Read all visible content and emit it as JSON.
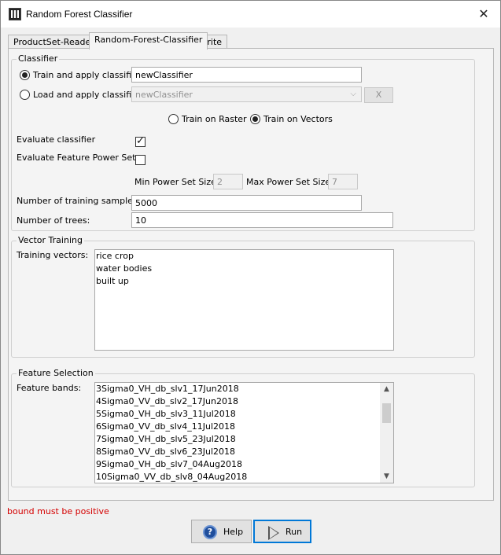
{
  "window": {
    "title": "Random Forest Classifier",
    "close_glyph": "✕",
    "app_icon": "raster-grid-icon"
  },
  "tabs": [
    {
      "label": "ProductSet-Reader",
      "active": false
    },
    {
      "label": "Random-Forest-Classifier",
      "active": true
    },
    {
      "label": "Write",
      "active": false
    }
  ],
  "classifier": {
    "legend": "Classifier",
    "train_apply_label": "Train and apply classifier",
    "train_apply_selected": true,
    "train_apply_name": "newClassifier",
    "load_apply_label": "Load and apply classifier",
    "load_apply_selected": false,
    "load_apply_name": "newClassifier",
    "delete_button_label": "X",
    "train_on_raster_label": "Train on Raster",
    "train_on_vectors_label": "Train on Vectors",
    "train_mode_selected": "vectors",
    "evaluate_classifier_label": "Evaluate classifier",
    "evaluate_classifier_checked": true,
    "evaluate_feature_power_set_label": "Evaluate Feature Power Set",
    "evaluate_feature_power_set_checked": false,
    "min_power_set_label": "Min Power Set Size:",
    "min_power_set_value": "2",
    "max_power_set_label": "Max Power Set Size:",
    "max_power_set_value": "7",
    "num_training_samples_label": "Number of training samples",
    "num_training_samples_value": "5000",
    "num_trees_label": "Number of trees:",
    "num_trees_value": "10"
  },
  "vector_training": {
    "legend": "Vector Training",
    "training_vectors_label": "Training vectors:",
    "items": [
      "rice crop",
      "water bodies",
      "built up"
    ]
  },
  "feature_selection": {
    "legend": "Feature Selection",
    "feature_bands_label": "Feature bands:",
    "items": [
      "3Sigma0_VH_db_slv1_17Jun2018",
      "4Sigma0_VV_db_slv2_17Jun2018",
      "5Sigma0_VH_db_slv3_11Jul2018",
      "6Sigma0_VV_db_slv4_11Jul2018",
      "7Sigma0_VH_db_slv5_23Jul2018",
      "8Sigma0_VV_db_slv6_23Jul2018",
      "9Sigma0_VH_db_slv7_04Aug2018",
      "10Sigma0_VV_db_slv8_04Aug2018"
    ]
  },
  "status": {
    "message": "bound must be positive",
    "color": "#d40000"
  },
  "buttons": {
    "help_label": "Help",
    "run_label": "Run"
  }
}
